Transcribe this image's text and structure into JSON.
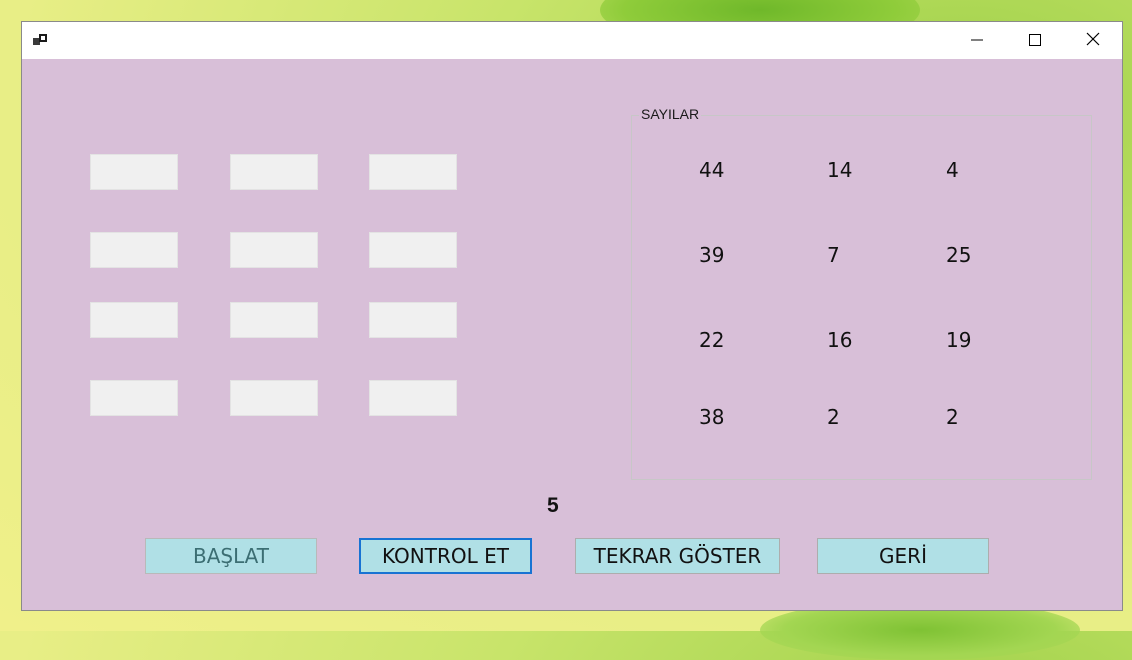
{
  "window": {
    "icons": {
      "app": "app-icon",
      "minimize": "minimize-icon",
      "maximize": "maximize-icon",
      "close": "close-icon"
    }
  },
  "input_grid": {
    "rows": 4,
    "cols": 3,
    "values": [
      "",
      "",
      "",
      "",
      "",
      "",
      "",
      "",
      "",
      "",
      "",
      ""
    ]
  },
  "numbers_group": {
    "title": "SAYILAR",
    "numbers": [
      [
        "44",
        "14",
        "4"
      ],
      [
        "39",
        "7",
        "25"
      ],
      [
        "22",
        "16",
        "19"
      ],
      [
        "38",
        "2",
        "2"
      ]
    ]
  },
  "result_label": "5",
  "buttons": {
    "start": "BAŞLAT",
    "check": "KONTROL ET",
    "show_again": "TEKRAR GÖSTER",
    "back": "GERİ"
  },
  "colors": {
    "form_background": "#d8bfd8",
    "button_background": "#b0e0e6",
    "focus_border": "#1873d3"
  }
}
